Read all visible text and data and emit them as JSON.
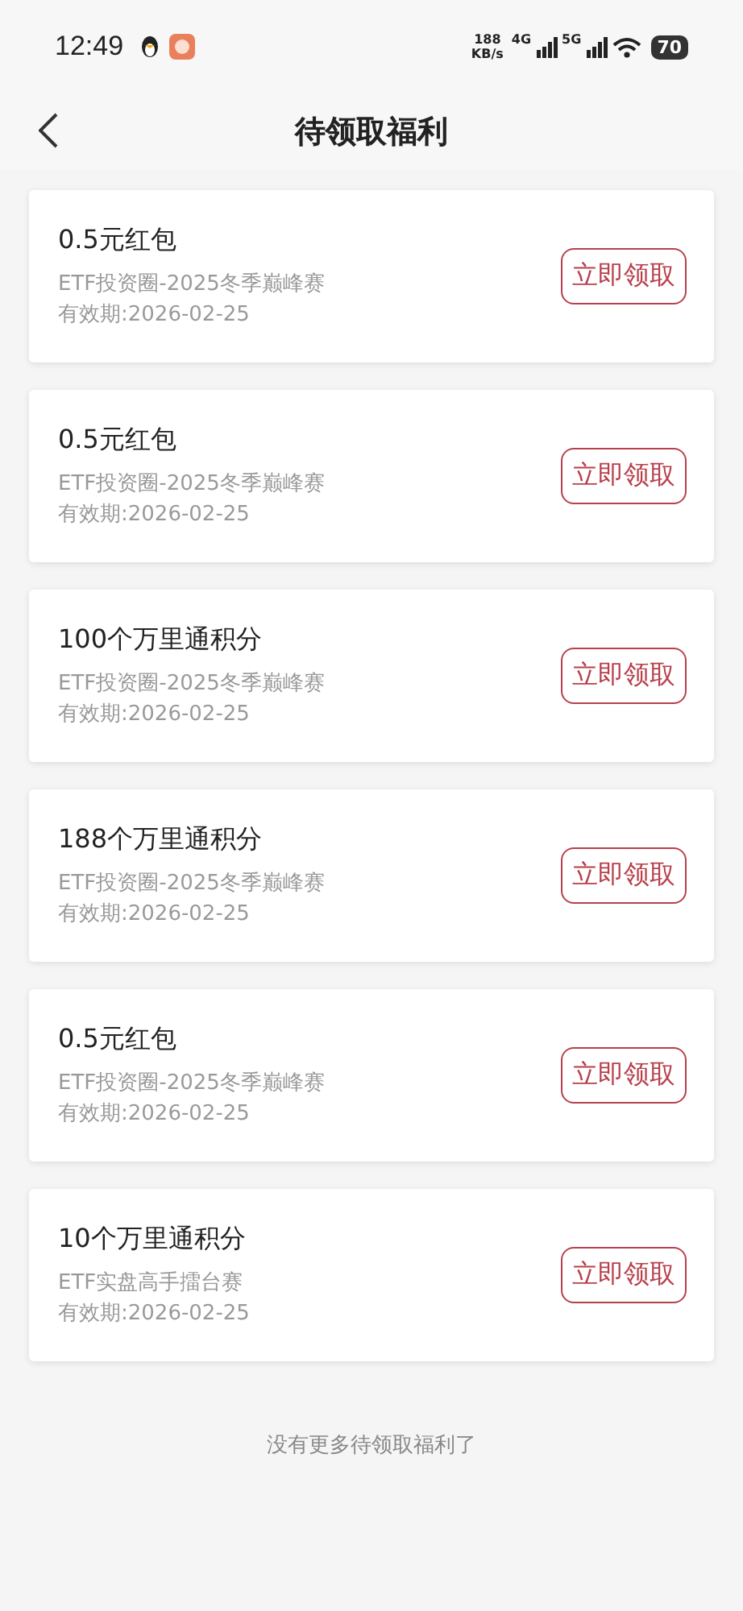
{
  "status_bar": {
    "time": "12:49",
    "speed": "188",
    "speed_unit": "KB/s",
    "network_1": "4G",
    "network_2": "5G",
    "battery": "70"
  },
  "header": {
    "title": "待领取福利"
  },
  "rewards": [
    {
      "title": "0.5元红包",
      "source": "ETF投资圈-2025冬季巅峰赛",
      "expiry": "有效期:2026-02-25",
      "action": "立即领取"
    },
    {
      "title": "0.5元红包",
      "source": "ETF投资圈-2025冬季巅峰赛",
      "expiry": "有效期:2026-02-25",
      "action": "立即领取"
    },
    {
      "title": "100个万里通积分",
      "source": "ETF投资圈-2025冬季巅峰赛",
      "expiry": "有效期:2026-02-25",
      "action": "立即领取"
    },
    {
      "title": "188个万里通积分",
      "source": "ETF投资圈-2025冬季巅峰赛",
      "expiry": "有效期:2026-02-25",
      "action": "立即领取"
    },
    {
      "title": "0.5元红包",
      "source": "ETF投资圈-2025冬季巅峰赛",
      "expiry": "有效期:2026-02-25",
      "action": "立即领取"
    },
    {
      "title": "10个万里通积分",
      "source": "ETF实盘高手擂台赛",
      "expiry": "有效期:2026-02-25",
      "action": "立即领取"
    }
  ],
  "footer": "没有更多待领取福利了"
}
